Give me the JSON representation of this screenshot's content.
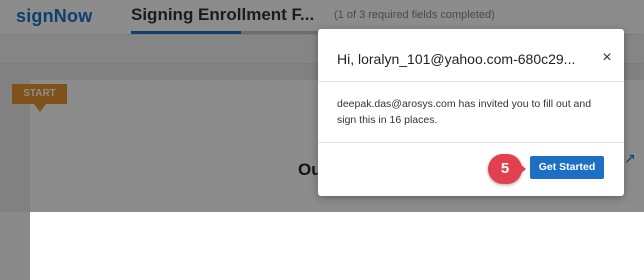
{
  "header": {
    "logo": "signNow",
    "document_title": "Signing Enrollment F...",
    "progress": "(1 of 3 required fields completed)"
  },
  "document": {
    "start_tag": "START",
    "heading": "Ou"
  },
  "modal": {
    "title": "Hi, loralyn_101@yahoo.com-680c29...",
    "close_label": "×",
    "message": "deepak.das@arosys.com has invited you to fill out and sign this in 16 places.",
    "get_started_label": "Get Started"
  },
  "annotation": {
    "step_number": "5"
  },
  "colors": {
    "brand": "#1a73c8",
    "start_tag": "#e8962e",
    "primary_button": "#1c6fc4",
    "step_badge": "#e3404f"
  }
}
